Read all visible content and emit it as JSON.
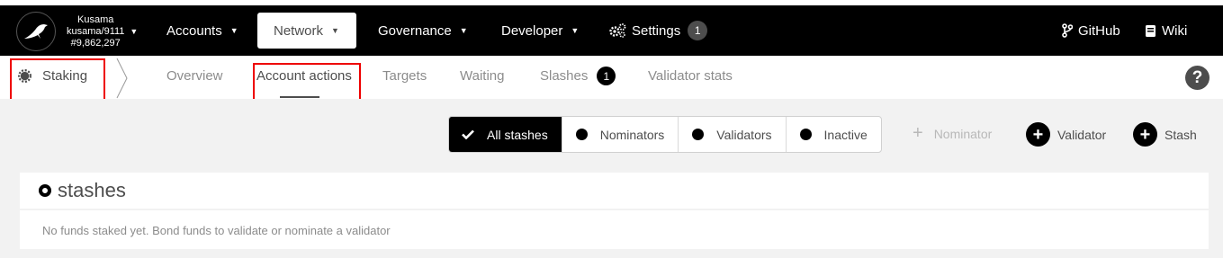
{
  "chain": {
    "name": "Kusama",
    "version": "kusama/9111",
    "block": "#9,862,297"
  },
  "topnav": {
    "accounts": "Accounts",
    "network": "Network",
    "governance": "Governance",
    "developer": "Developer",
    "settings": "Settings",
    "settings_badge": "1",
    "github": "GitHub",
    "wiki": "Wiki"
  },
  "section": {
    "title": "Staking",
    "icon": "gear-icon"
  },
  "tabs": {
    "overview": "Overview",
    "account_actions": "Account actions",
    "targets": "Targets",
    "waiting": "Waiting",
    "slashes": "Slashes",
    "slashes_badge": "1",
    "validator_stats": "Validator stats"
  },
  "help_label": "?",
  "filters": {
    "all_stashes": "All stashes",
    "nominators": "Nominators",
    "validators": "Validators",
    "inactive": "Inactive"
  },
  "actions": {
    "nominator": "Nominator",
    "validator": "Validator",
    "stash": "Stash"
  },
  "stashes": {
    "title": "stashes",
    "empty": "No funds staked yet. Bond funds to validate or nominate a validator"
  },
  "colors": {
    "topbar": "#000000",
    "highlight": "#e00000",
    "background": "#f2f2f2"
  }
}
